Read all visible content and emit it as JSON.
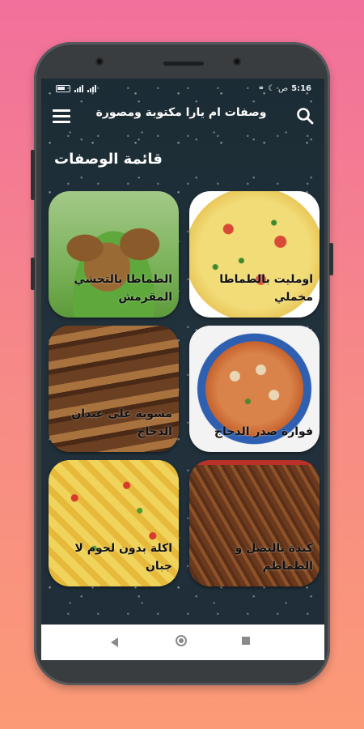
{
  "status_bar": {
    "time": "5:16",
    "ampm": "ص"
  },
  "app_bar": {
    "title": "وصفات ام يارا مكتوبة ومصورة"
  },
  "main": {
    "section_title": "قائمة الوصفات",
    "recipes": [
      {
        "label": "اومليت بالطماطا مخملي"
      },
      {
        "label": "الطماطا بالتحشي المقرمش"
      },
      {
        "label": "فوارة صدر الدجاج"
      },
      {
        "label": "مشوية على عيدان الدجاج"
      },
      {
        "label": "كبدة بالبصل و الطماطم"
      },
      {
        "label": "اكلة بدون لحوم لا جبان"
      }
    ]
  },
  "colors": {
    "background_top": "#f1709c",
    "background_bottom": "#fb9a76",
    "app_background": "#1f2e38",
    "text": "#ffffff"
  }
}
